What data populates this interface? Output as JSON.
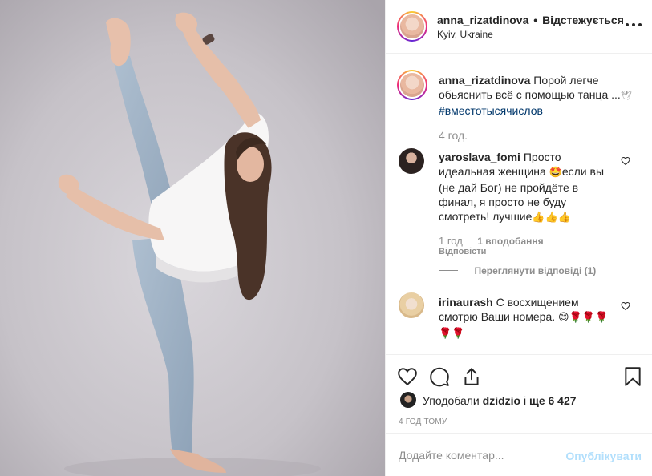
{
  "post": {
    "username": "anna_rizatdinova",
    "separator": "•",
    "follow_status": "Відстежується",
    "location": "Kyiv, Ukraine"
  },
  "caption": {
    "username": "anna_rizatdinova",
    "text": "Порой легче обьяснить всё с помощью танца ...",
    "emoji": "🕊",
    "hashtag": "#вместотысячислов",
    "time": "4 год."
  },
  "comments": [
    {
      "username": "yaroslava_fomi",
      "text_lines": [
        "Просто",
        "идеальная женщина",
        "если вы",
        "(не дай Бог) не пройдёте в",
        "финал, я просто не буду",
        "смотреть! лучшие"
      ],
      "emoji_1": "🤩",
      "emoji_2": "👍👍👍",
      "time": "1 год",
      "likes": "1 вподобання",
      "reply": "Відповісти",
      "view_replies": "Переглянути відповіді (1)"
    },
    {
      "username": "irinaurash",
      "text_lines": [
        "С восхищением",
        "смотрю Ваши номера."
      ],
      "emoji_1": "😊🌹🌹🌹",
      "emoji_2": "🌹🌹"
    }
  ],
  "actions": {
    "liked_by_prefix": "Уподобали",
    "liked_by_user": "dzidzio",
    "liked_by_and": "і",
    "liked_by_others": "ще 6 427",
    "time_ago": "4 ГОД ТОМУ"
  },
  "add_comment": {
    "placeholder": "Додайте коментар...",
    "post_label": "Опублікувати"
  },
  "icons": {
    "more": "more-horizontal-icon",
    "like": "heart-icon",
    "comment": "comment-icon",
    "share": "share-icon",
    "save": "bookmark-icon"
  },
  "colors": {
    "link": "#00376b",
    "muted": "#8e8e8e",
    "post_disabled": "#b2dffc",
    "border": "#efefef"
  }
}
